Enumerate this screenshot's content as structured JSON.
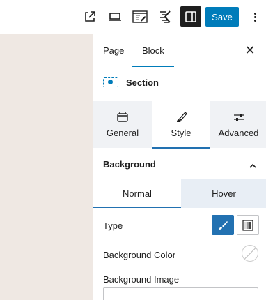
{
  "toolbar": {
    "icons": [
      "external-link-icon",
      "desktop-preview-icon",
      "edit-template-icon",
      "kadence-icon",
      "sidebar-toggle-icon"
    ],
    "save_label": "Save",
    "more_icon": "more-vertical-icon"
  },
  "sidebar": {
    "tabs": [
      {
        "label": "Page"
      },
      {
        "label": "Block"
      }
    ],
    "active_tab": "Block",
    "close_icon": "close-icon",
    "block": {
      "icon": "section-block-icon",
      "title": "Section"
    },
    "categories": [
      {
        "label": "General",
        "icon": "general-icon"
      },
      {
        "label": "Style",
        "icon": "style-brush-icon"
      },
      {
        "label": "Advanced",
        "icon": "sliders-icon"
      }
    ],
    "active_category": "Style",
    "panel": {
      "title": "Background",
      "expanded": true
    },
    "states": [
      {
        "label": "Normal"
      },
      {
        "label": "Hover"
      }
    ],
    "active_state": "Normal",
    "type_label": "Type",
    "type_options": [
      {
        "name": "classic",
        "icon": "brush-icon",
        "selected": true
      },
      {
        "name": "gradient",
        "icon": "gradient-icon",
        "selected": false
      }
    ],
    "bg_color_label": "Background Color",
    "bg_image_label": "Background Image"
  },
  "colors": {
    "accent": "#007cba",
    "canvas": "#efe8e3",
    "inactive_tab": "#f0f2f5",
    "hover_tab": "#e8eef5"
  }
}
